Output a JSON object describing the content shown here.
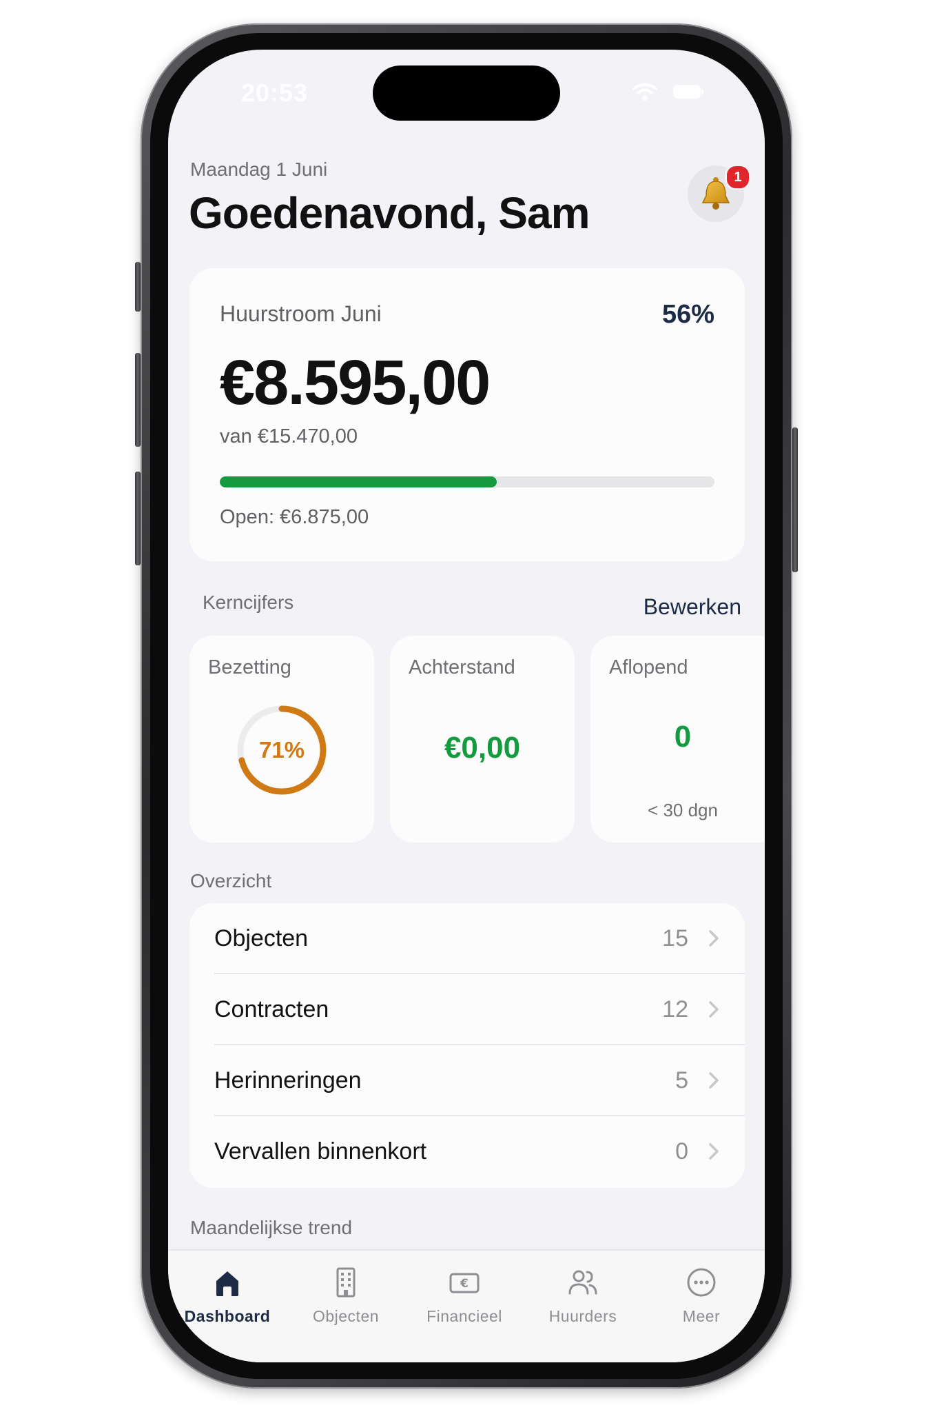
{
  "status_bar": {
    "time": "20:53"
  },
  "header": {
    "date": "Maandag 1 Juni",
    "greeting": "Goedenavond, Sam",
    "notification_count": "1"
  },
  "rent_card": {
    "title": "Huurstroom Juni",
    "percentage": "56%",
    "progress_fraction": 0.56,
    "amount": "€8.595,00",
    "of_total": "van €15.470,00",
    "open": "Open: €6.875,00"
  },
  "kpis": {
    "section_label": "Kerncijfers",
    "edit_label": "Bewerken",
    "occupancy": {
      "title": "Bezetting",
      "value": "71%",
      "fraction": 0.71
    },
    "arrears": {
      "title": "Achterstand",
      "value": "€0,00"
    },
    "expiring": {
      "title": "Aflopend",
      "value": "0",
      "sub": "< 30 dgn"
    }
  },
  "overview": {
    "section_label": "Overzicht",
    "rows": [
      {
        "label": "Objecten",
        "count": "15"
      },
      {
        "label": "Contracten",
        "count": "12"
      },
      {
        "label": "Herinneringen",
        "count": "5"
      },
      {
        "label": "Vervallen binnenkort",
        "count": "0"
      }
    ]
  },
  "trend": {
    "section_label": "Maandelijkse trend"
  },
  "tab_bar": {
    "tabs": [
      {
        "label": "Dashboard",
        "icon": "home-icon",
        "active": true
      },
      {
        "label": "Objecten",
        "icon": "building-icon",
        "active": false
      },
      {
        "label": "Financieel",
        "icon": "euro-banknote-icon",
        "active": false
      },
      {
        "label": "Huurders",
        "icon": "people-icon",
        "active": false
      },
      {
        "label": "Meer",
        "icon": "more-icon",
        "active": false
      }
    ]
  },
  "colors": {
    "accent_navy": "#1d2b45",
    "success_green": "#149a3f",
    "warning_orange": "#cf7a14",
    "badge_red": "#e0252b",
    "background": "#f2f2f7"
  }
}
